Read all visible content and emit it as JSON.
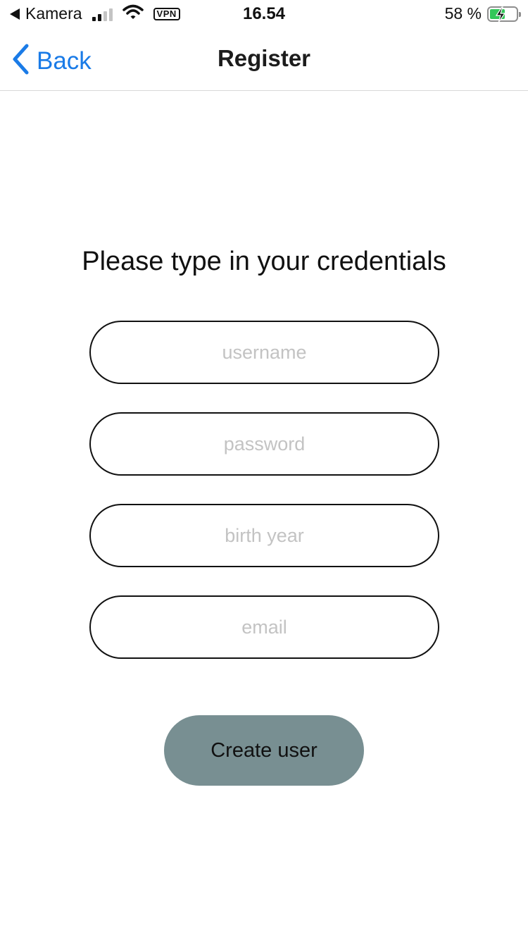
{
  "status_bar": {
    "back_app": "Kamera",
    "time": "16.54",
    "vpn": "VPN",
    "battery_percent": "58 %",
    "battery_level": 0.58,
    "battery_color": "#33c759",
    "icons": [
      "back-triangle-icon",
      "signal-icon",
      "wifi-icon",
      "vpn-icon",
      "battery-icon",
      "charging-bolt-icon"
    ]
  },
  "nav": {
    "back_label": "Back",
    "title": "Register",
    "accent_color": "#1a7be7"
  },
  "form": {
    "heading": "Please type in your credentials",
    "fields": [
      {
        "placeholder": "username",
        "value": ""
      },
      {
        "placeholder": "password",
        "value": ""
      },
      {
        "placeholder": "birth year",
        "value": ""
      },
      {
        "placeholder": "email",
        "value": ""
      }
    ],
    "submit_label": "Create user",
    "submit_color": "#788f92"
  }
}
